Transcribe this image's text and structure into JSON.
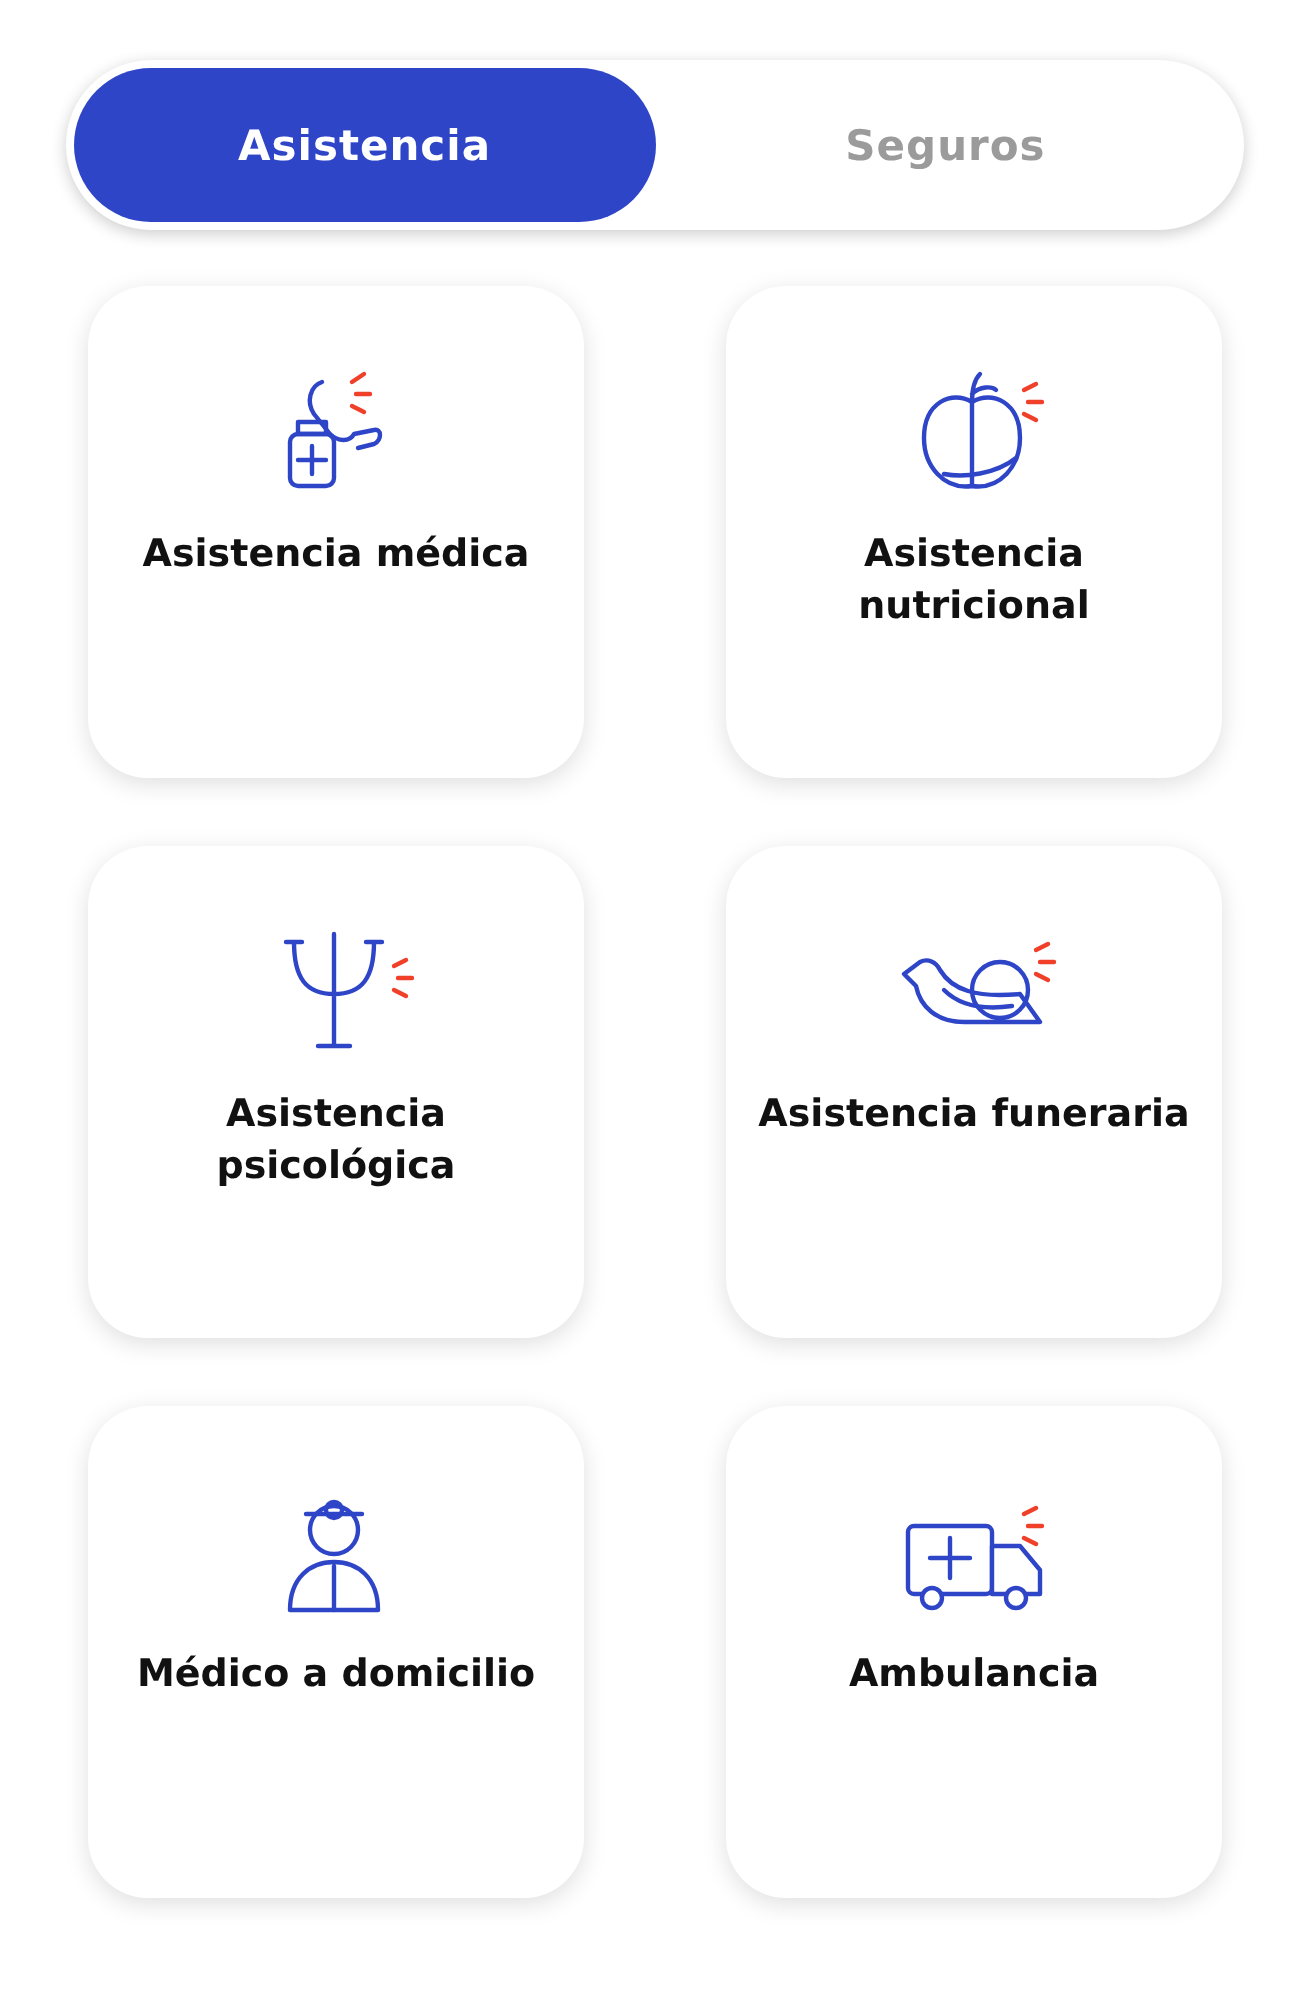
{
  "tabs": [
    {
      "label": "Asistencia",
      "selected": true
    },
    {
      "label": "Seguros",
      "selected": false
    }
  ],
  "services": [
    {
      "kind": "phone",
      "label": "Asistencia médica"
    },
    {
      "kind": "apple",
      "label": "Asistencia nutricional"
    },
    {
      "kind": "psi",
      "label": "Asistencia psicológica"
    },
    {
      "kind": "bird",
      "label": "Asistencia funeraria"
    },
    {
      "kind": "doctor",
      "label": "Médico a domicilio"
    },
    {
      "kind": "ambulance",
      "label": "Ambulancia"
    }
  ]
}
